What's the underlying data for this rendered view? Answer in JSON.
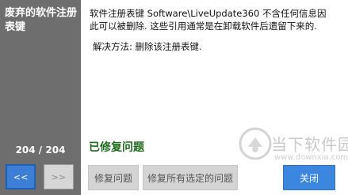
{
  "sidebar": {
    "title": "废弃的软件注册表键",
    "counter": "204 / 204",
    "prev_label": "<<",
    "next_label": ">>"
  },
  "content": {
    "description": "软件注册表键 Software\\LiveUpdate360 不含任何信息因此可以被删除. 这些引用通常是在卸载软件后遗留下来的.",
    "solution": "解决方法: 删除该注册表键."
  },
  "status": {
    "fixed_text": "已修复问题"
  },
  "buttons": {
    "fix_label": "修复问题",
    "fix_all_label": "修复所有选定的问题",
    "close_label": "关闭"
  },
  "watermark": {
    "text": "当下软件园",
    "url": "www.downxia.com"
  },
  "colors": {
    "sidebar_bg": "#6e6e6e",
    "accent": "#3b86de",
    "status_green": "#1e6b1e"
  }
}
